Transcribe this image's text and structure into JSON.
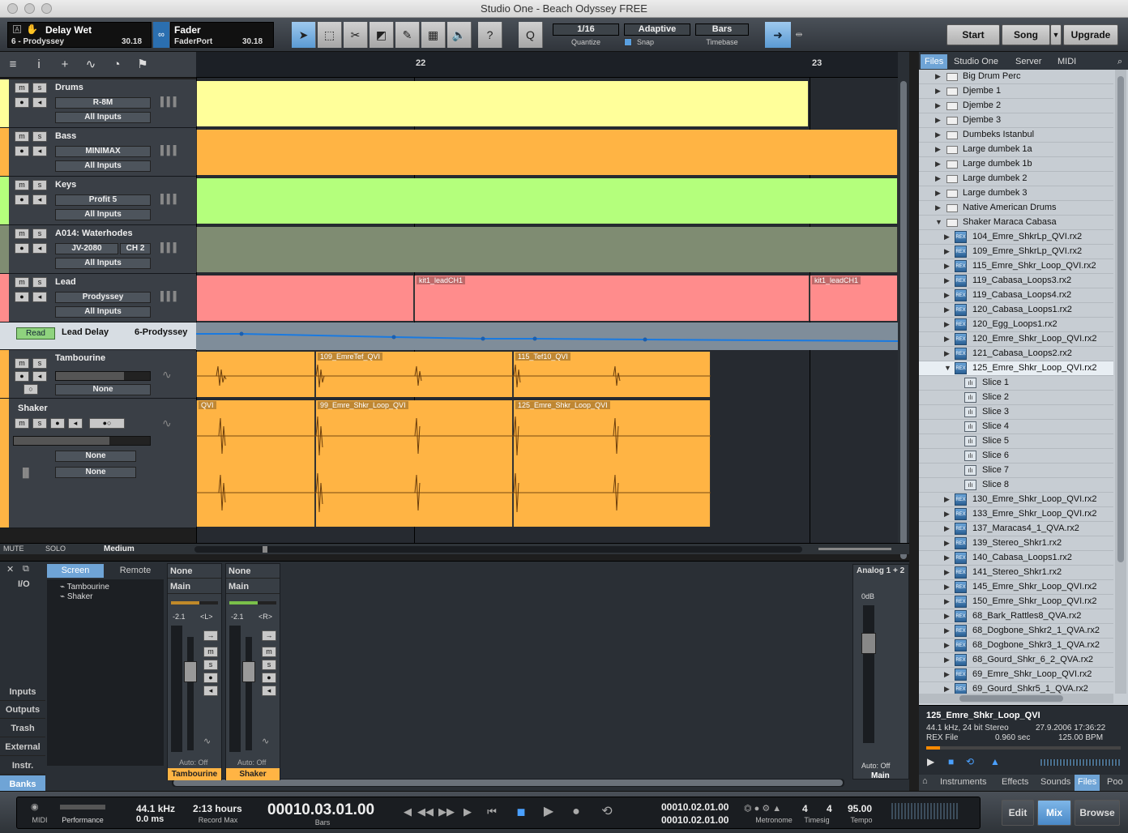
{
  "window": {
    "title": "Studio One - Beach Odyssey FREE"
  },
  "toolbar": {
    "inspector_name": "Delay Wet",
    "inspector_track": "6 - Prodyssey",
    "inspector_val": "30.18",
    "fader_name": "Fader",
    "fader_sub": "FaderPort",
    "fader_val": "30.18",
    "quantize_value": "1/16",
    "quantize_label": "Quantize",
    "snap_value": "Adaptive",
    "snap_label": "Snap",
    "timebase_value": "Bars",
    "timebase_label": "Timebase",
    "start": "Start",
    "song": "Song",
    "upgrade": "Upgrade"
  },
  "ruler": {
    "marks": [
      "22",
      "23"
    ]
  },
  "tracks": [
    {
      "name": "Drums",
      "chip": "R-8M",
      "input": "All Inputs",
      "color": "#ffff9a"
    },
    {
      "name": "Bass",
      "chip": "MINIMAX",
      "input": "All Inputs",
      "color": "#ffb444"
    },
    {
      "name": "Keys",
      "chip": "Profit 5",
      "input": "All Inputs",
      "color": "#b4ff7c"
    },
    {
      "name": "A014: Waterhodes",
      "chip": "JV-2080",
      "chip2": "CH 2",
      "input": "All Inputs",
      "color": "#7f8c72"
    },
    {
      "name": "Lead",
      "chip": "Prodyssey",
      "input": "All Inputs",
      "color": "#ff8c8c"
    }
  ],
  "automation": {
    "mode": "Read",
    "name": "Lead Delay",
    "device": "6-Prodyssey"
  },
  "tambourine": {
    "name": "Tambourine",
    "out": "None"
  },
  "shaker": {
    "name": "Shaker",
    "out1": "None",
    "out2": "None"
  },
  "clips": {
    "lead1": "kit1_leadCH1",
    "lead2": "kit1_leadCH1",
    "t1": "109_EmreTef_QVI",
    "t2": "115_Tef10_QVI",
    "s0": "QVI",
    "s1": "99_Emre_Shkr_Loop_QVI",
    "s2": "125_Emre_Shkr_Loop_QVI"
  },
  "bottom_bar": {
    "mute": "MUTE",
    "solo": "SOLO",
    "size": "Medium"
  },
  "browser": {
    "tabs": [
      "Files",
      "Studio One",
      "Server",
      "MIDI"
    ],
    "items": [
      {
        "label": "Big Drum Perc",
        "kind": "folder"
      },
      {
        "label": "Djembe 1",
        "kind": "folder"
      },
      {
        "label": "Djembe 2",
        "kind": "folder"
      },
      {
        "label": "Djembe 3",
        "kind": "folder"
      },
      {
        "label": "Dumbeks Istanbul",
        "kind": "folder"
      },
      {
        "label": "Large dumbek 1a",
        "kind": "folder"
      },
      {
        "label": "Large dumbek 1b",
        "kind": "folder"
      },
      {
        "label": "Large dumbek 2",
        "kind": "folder"
      },
      {
        "label": "Large dumbek 3",
        "kind": "folder"
      },
      {
        "label": "Native American Drums",
        "kind": "folder"
      },
      {
        "label": "Shaker Maraca Cabasa",
        "kind": "folder-open"
      },
      {
        "label": "104_Emre_ShkrLp_QVI.rx2",
        "kind": "rex"
      },
      {
        "label": "109_Emre_ShkrLp_QVI.rx2",
        "kind": "rex"
      },
      {
        "label": "115_Emre_Shkr_Loop_QVI.rx2",
        "kind": "rex"
      },
      {
        "label": "119_Cabasa_Loops3.rx2",
        "kind": "rex"
      },
      {
        "label": "119_Cabasa_Loops4.rx2",
        "kind": "rex"
      },
      {
        "label": "120_Cabasa_Loops1.rx2",
        "kind": "rex"
      },
      {
        "label": "120_Egg_Loops1.rx2",
        "kind": "rex"
      },
      {
        "label": "120_Emre_Shkr_Loop_QVI.rx2",
        "kind": "rex"
      },
      {
        "label": "121_Cabasa_Loops2.rx2",
        "kind": "rex"
      },
      {
        "label": "125_Emre_Shkr_Loop_QVI.rx2",
        "kind": "rex-open"
      },
      {
        "label": "Slice 1",
        "kind": "slice"
      },
      {
        "label": "Slice 2",
        "kind": "slice"
      },
      {
        "label": "Slice 3",
        "kind": "slice"
      },
      {
        "label": "Slice 4",
        "kind": "slice"
      },
      {
        "label": "Slice 5",
        "kind": "slice"
      },
      {
        "label": "Slice 6",
        "kind": "slice"
      },
      {
        "label": "Slice 7",
        "kind": "slice"
      },
      {
        "label": "Slice 8",
        "kind": "slice"
      },
      {
        "label": "130_Emre_Shkr_Loop_QVI.rx2",
        "kind": "rex"
      },
      {
        "label": "133_Emre_Shkr_Loop_QVI.rx2",
        "kind": "rex"
      },
      {
        "label": "137_Maracas4_1_QVA.rx2",
        "kind": "rex"
      },
      {
        "label": "139_Stereo_Shkr1.rx2",
        "kind": "rex"
      },
      {
        "label": "140_Cabasa_Loops1.rx2",
        "kind": "rex"
      },
      {
        "label": "141_Stereo_Shkr1.rx2",
        "kind": "rex"
      },
      {
        "label": "145_Emre_Shkr_Loop_QVI.rx2",
        "kind": "rex"
      },
      {
        "label": "150_Emre_Shkr_Loop_QVI.rx2",
        "kind": "rex"
      },
      {
        "label": "68_Bark_Rattles8_QVA.rx2",
        "kind": "rex"
      },
      {
        "label": "68_Dogbone_Shkr2_1_QVA.rx2",
        "kind": "rex"
      },
      {
        "label": "68_Dogbone_Shkr3_1_QVA.rx2",
        "kind": "rex"
      },
      {
        "label": "68_Gourd_Shkr_6_2_QVA.rx2",
        "kind": "rex"
      },
      {
        "label": "69_Emre_Shkr_Loop_QVI.rx2",
        "kind": "rex"
      },
      {
        "label": "69_Gourd_Shkr5_1_QVA.rx2",
        "kind": "rex"
      }
    ],
    "selected": 20,
    "info_name": "125_Emre_Shkr_Loop_QVI",
    "info_format": "44.1 kHz, 24 bit Stereo",
    "info_date": "27.9.2006 17:36:22",
    "info_type": "REX File",
    "info_len": "0.960 sec",
    "info_bpm": "125.00 BPM",
    "bottom_tabs": [
      "Instruments",
      "Effects",
      "Sounds",
      "Files"
    ],
    "bottom_tab_extra": "Poo"
  },
  "console": {
    "tabs": [
      "Screen",
      "Remote"
    ],
    "io": "I/O",
    "list": [
      "Tambourine",
      "Shaker"
    ],
    "side": [
      "Inputs",
      "Outputs",
      "Trash",
      "External",
      "Instr.",
      "Banks"
    ],
    "strips": [
      {
        "in": "None",
        "out": "Main",
        "pan": "-2.1",
        "pan_side": "<L>",
        "auto": "Auto: Off",
        "name": "Tambourine"
      },
      {
        "in": "None",
        "out": "Main",
        "pan": "-2.1",
        "pan_side": "<R>",
        "auto": "Auto: Off",
        "name": "Shaker"
      }
    ],
    "main_io": "Analog 1 + 2",
    "main_db": "0dB",
    "main_auto": "Auto: Off",
    "main_name": "Main",
    "scale": [
      "6",
      "0",
      "-3",
      "-6",
      "-12",
      "-24",
      "-36",
      "-48",
      "-60"
    ]
  },
  "transport": {
    "midi": "MIDI",
    "perf": "Performance",
    "rate": "44.1 kHz",
    "latency": "0.0 ms",
    "rec_time": "2:13 hours",
    "rec_label": "Record Max",
    "position": "00010.03.01.00",
    "pos_label": "Bars",
    "loop_l": "00010.02.01.00",
    "loop_r": "00010.02.01.00",
    "metronome": "Metronome",
    "timesig_n": "4",
    "timesig_d": "4",
    "timesig_label": "Timesig",
    "tempo": "95.00",
    "tempo_label": "Tempo",
    "edit": "Edit",
    "mix": "Mix",
    "browse": "Browse"
  }
}
